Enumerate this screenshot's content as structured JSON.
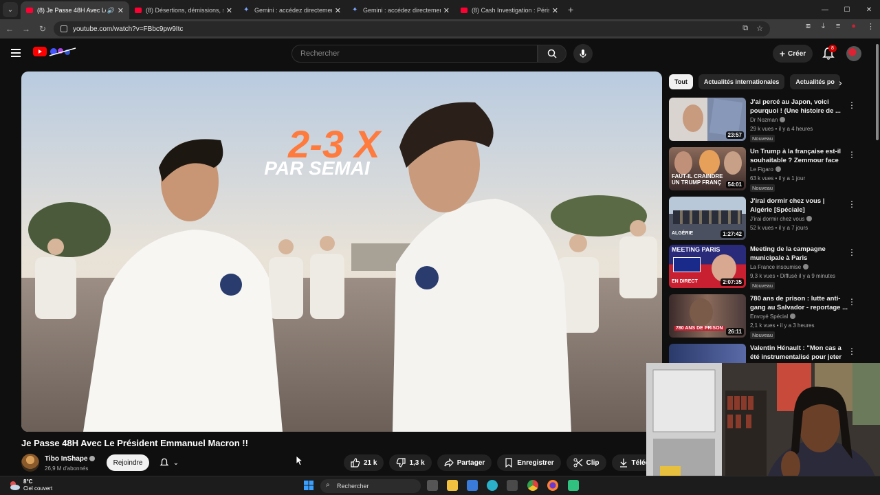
{
  "browser": {
    "tabs": [
      {
        "title": "(8) Je Passe 48H Avec Le Pr",
        "favicon": "youtube-icon",
        "active": true,
        "audio": true
      },
      {
        "title": "(8) Désertions, démissions, suic",
        "favicon": "youtube-icon",
        "active": false
      },
      {
        "title": "Gemini : accédez directement à",
        "favicon": "gemini-icon",
        "active": false
      },
      {
        "title": "Gemini : accédez directement à",
        "favicon": "gemini-icon",
        "active": false
      },
      {
        "title": "(8) Cash Investigation : Périscol",
        "favicon": "youtube-icon",
        "active": false
      }
    ],
    "url": "youtube.com/watch?v=FBbc9pw9Itc"
  },
  "youtube": {
    "search_placeholder": "Rechercher",
    "create_label": "Créer",
    "notif_count": "8"
  },
  "video": {
    "overlay_line1": "2-3 X",
    "overlay_line2": "PAR SEMAI",
    "title": "Je Passe 48H Avec Le Président Emmanuel Macron !!",
    "channel": "Tibo InShape",
    "subscribers": "26,9 M d'abonnés",
    "join_label": "Rejoindre",
    "likes": "21 k",
    "dislikes": "1,3 k",
    "share_label": "Partager",
    "save_label": "Enregistrer",
    "clip_label": "Clip",
    "download_label": "Télécharger"
  },
  "chips": [
    "Tout",
    "Actualités internationales",
    "Actualités po"
  ],
  "recommendations": [
    {
      "title": "J'ai percé au Japon, voici pourquoi ! (Une histoire de ...",
      "channel": "Dr Nozman",
      "meta": "29 k vues • il y a 4 heures",
      "badge": "Nouveau",
      "duration": "23:57"
    },
    {
      "title": "Un Trump à la française est-il souhaitable ? Zemmour face à...",
      "channel": "Le Figaro",
      "meta": "63 k vues • il y a 1 jour",
      "badge": "Nouveau",
      "duration": "54:01",
      "thumb_text": "FAUT-IL CRAINDRE UN TRUMP FRANÇ"
    },
    {
      "title": "J'irai dormir chez vous | Algérie [Spéciale]",
      "channel": "J'irai dormir chez vous",
      "meta": "52 k vues • il y a 7 jours",
      "badge": "",
      "duration": "1:27:42",
      "thumb_text": "ALGÉRIE"
    },
    {
      "title": "Meeting de la campagne municipale à Paris",
      "channel": "La France insoumise",
      "meta": "9,3 k vues • Diffusé il y a 9 minutes",
      "badge": "Nouveau",
      "duration": "2:07:35",
      "thumb_text": "MEETING PARIS",
      "thumb_sub": "EN DIRECT"
    },
    {
      "title": "780 ans de prison : lutte anti-gang au Salvador - reportage ...",
      "channel": "Envoyé Spécial",
      "meta": "2,1 k vues • il y a 3 heures",
      "badge": "Nouveau",
      "duration": "26:11",
      "thumb_text": "780 ANS DE PRISON"
    },
    {
      "title": "Valentin Hénault : \"Mon cas a été instrumentalisé pour jeter l...",
      "channel": "",
      "meta": "",
      "badge": "",
      "duration": ""
    }
  ],
  "taskbar": {
    "temperature": "8°C",
    "weather": "Ciel couvert",
    "search_label": "Rechercher"
  },
  "colors": {
    "youtube_red": "#ff0000",
    "background": "#0f0f0f",
    "chip_bg": "#272727"
  }
}
